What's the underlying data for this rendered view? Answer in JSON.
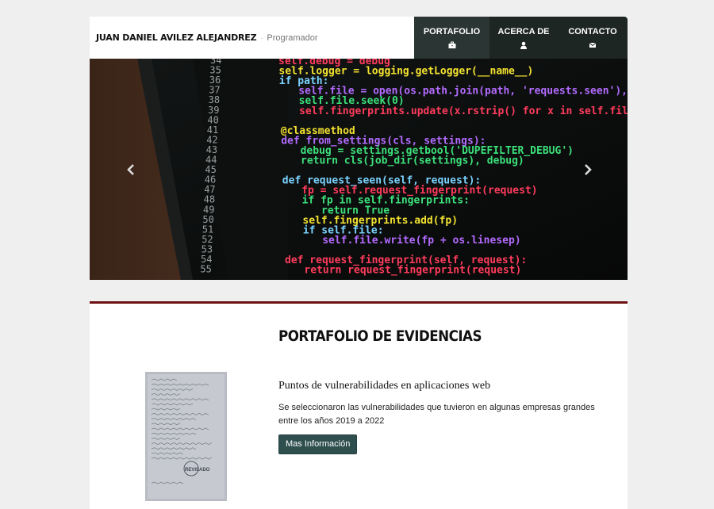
{
  "header": {
    "brand_name": "JUAN DANIEL AVILEZ ALEJANDREZ",
    "separator": "·",
    "role": "Programador"
  },
  "nav": {
    "items": [
      {
        "label": "PORTAFOLIO",
        "icon": "briefcase-icon",
        "active": true
      },
      {
        "label": "ACERCA DE",
        "icon": "user-icon",
        "active": false
      },
      {
        "label": "CONTACTO",
        "icon": "envelope-icon",
        "active": false
      }
    ]
  },
  "carousel": {
    "prev_icon": "chevron-left-icon",
    "next_icon": "chevron-right-icon",
    "line_numbers": [
      "34",
      "35",
      "36",
      "37",
      "38",
      "39",
      "40",
      "41",
      "42",
      "43",
      "44",
      "45",
      "46",
      "47",
      "48",
      "49",
      "50",
      "51",
      "52",
      "53",
      "54",
      "55"
    ],
    "code_lines": [
      "self.debug = debug",
      "self.logger = logging.getLogger(__name__)",
      "if path:",
      "self.file = open(os.path.join(path, 'requests.seen'), 'a+')",
      "self.file.seek(0)",
      "self.fingerprints.update(x.rstrip() for x in self.file)",
      "",
      "@classmethod",
      "def from_settings(cls, settings):",
      "debug = settings.getbool('DUPEFILTER_DEBUG')",
      "return cls(job_dir(settings), debug)",
      "",
      "def request_seen(self, request):",
      "fp = self.request_fingerprint(request)",
      "if fp in self.fingerprints:",
      "return True",
      "self.fingerprints.add(fp)",
      "if self.file:",
      "self.file.write(fp + os.linesep)",
      "",
      "def request_fingerprint(self, request):",
      "return request_fingerprint(request)"
    ]
  },
  "portfolio": {
    "title": "PORTAFOLIO DE EVIDENCIAS",
    "items": [
      {
        "title": "Puntos de vulnerabilidades en aplicaciones web",
        "description": "Se seleccionaron las vulnerabilidades que tuvieron en algunas empresas grandes entre los años 2019 a 2022",
        "button_label": "Mas Información",
        "stamp_text": "REVISADO"
      }
    ]
  },
  "colors": {
    "nav_bg": "#1e2624",
    "accent_border": "#6e1010",
    "button_bg": "#2f4f4f"
  }
}
